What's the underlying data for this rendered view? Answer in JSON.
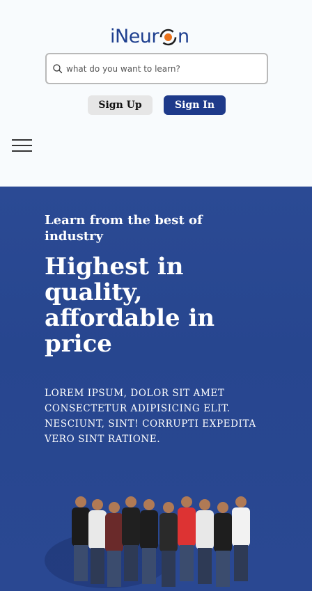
{
  "brand": {
    "logo_text_left": "iNeur",
    "logo_text_right": "n"
  },
  "search": {
    "placeholder": "what do you want to learn?"
  },
  "auth": {
    "signup_label": "Sign Up",
    "signin_label": "Sign In"
  },
  "hero": {
    "subtitle": "Learn from the best of industry",
    "title": "Highest in quality, affordable in price",
    "description": "Lorem ipsum, dolor sit amet consectetur adipisicing elit. Nesciunt, sint! Corrupti expedita vero sint ratione."
  },
  "colors": {
    "brand_blue": "#1e3f8f",
    "accent_orange": "#e8711a",
    "hero_bg": "#2b4a94",
    "signin_bg": "#1e3a8a"
  },
  "icons": {
    "search": "search-icon",
    "menu": "hamburger-menu-icon",
    "team": "team-photo"
  }
}
